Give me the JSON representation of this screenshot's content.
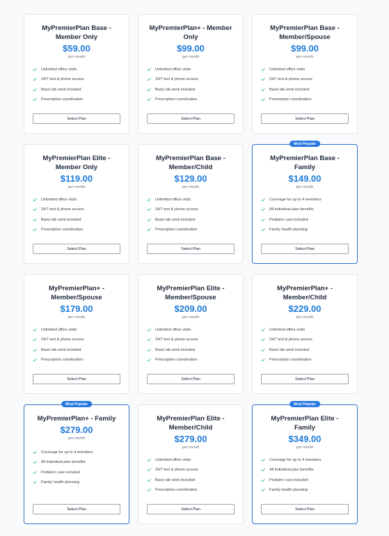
{
  "theme": {
    "accent": "#1d7ad8",
    "popular_border": "#2f6fc6",
    "check": "#22c55e"
  },
  "plans": [
    {
      "title": "MyPremierPlan Base - Member Only",
      "price": "$59.00",
      "per": "per month",
      "popular": false,
      "features": [
        "Unlimited office visits",
        "24/7 text & phone access",
        "Basic lab work included",
        "Prescription coordination"
      ],
      "button": "Select Plan"
    },
    {
      "title": "MyPremierPlan+ - Member Only",
      "price": "$99.00",
      "per": "per month",
      "popular": false,
      "features": [
        "Unlimited office visits",
        "24/7 text & phone access",
        "Basic lab work included",
        "Prescription coordination"
      ],
      "button": "Select Plan"
    },
    {
      "title": "MyPremierPlan Base - Member/Spouse",
      "price": "$99.00",
      "per": "per month",
      "popular": false,
      "features": [
        "Unlimited office visits",
        "24/7 text & phone access",
        "Basic lab work included",
        "Prescription coordination"
      ],
      "button": "Select Plan"
    },
    {
      "title": "MyPremierPlan Elite - Member Only",
      "price": "$119.00",
      "per": "per month",
      "popular": false,
      "features": [
        "Unlimited office visits",
        "24/7 text & phone access",
        "Basic lab work included",
        "Prescription coordination"
      ],
      "button": "Select Plan"
    },
    {
      "title": "MyPremierPlan Base - Member/Child",
      "price": "$129.00",
      "per": "per month",
      "popular": false,
      "features": [
        "Unlimited office visits",
        "24/7 text & phone access",
        "Basic lab work included",
        "Prescription coordination"
      ],
      "button": "Select Plan"
    },
    {
      "title": "MyPremierPlan Base - Family",
      "price": "$149.00",
      "per": "per month",
      "popular": true,
      "badge": "Most Popular",
      "features": [
        "Coverage for up to 4 members",
        "All Individual plan benefits",
        "Pediatric care included",
        "Family health planning"
      ],
      "button": "Select Plan"
    },
    {
      "title": "MyPremierPlan+ - Member/Spouse",
      "price": "$179.00",
      "per": "per month",
      "popular": false,
      "features": [
        "Unlimited office visits",
        "24/7 text & phone access",
        "Basic lab work included",
        "Prescription coordination"
      ],
      "button": "Select Plan"
    },
    {
      "title": "MyPremierPlan Elite - Member/Spouse",
      "price": "$209.00",
      "per": "per month",
      "popular": false,
      "features": [
        "Unlimited office visits",
        "24/7 text & phone access",
        "Basic lab work included",
        "Prescription coordination"
      ],
      "button": "Select Plan"
    },
    {
      "title": "MyPremierPlan+ - Member/Child",
      "price": "$229.00",
      "per": "per month",
      "popular": false,
      "features": [
        "Unlimited office visits",
        "24/7 text & phone access",
        "Basic lab work included",
        "Prescription coordination"
      ],
      "button": "Select Plan"
    },
    {
      "title": "MyPremierPlan+ - Family",
      "price": "$279.00",
      "per": "per month",
      "popular": true,
      "badge": "Most Popular",
      "features": [
        "Coverage for up to 4 members",
        "All Individual plan benefits",
        "Pediatric care included",
        "Family health planning"
      ],
      "button": "Select Plan"
    },
    {
      "title": "MyPremierPlan Elite - Member/Child",
      "price": "$279.00",
      "per": "per month",
      "popular": false,
      "features": [
        "Unlimited office visits",
        "24/7 text & phone access",
        "Basic lab work included",
        "Prescription coordination"
      ],
      "button": "Select Plan"
    },
    {
      "title": "MyPremierPlan Elite - Family",
      "price": "$349.00",
      "per": "per month",
      "popular": true,
      "badge": "Most Popular",
      "features": [
        "Coverage for up to 4 members",
        "All Individual plan benefits",
        "Pediatric care included",
        "Family health planning"
      ],
      "button": "Select Plan"
    }
  ]
}
